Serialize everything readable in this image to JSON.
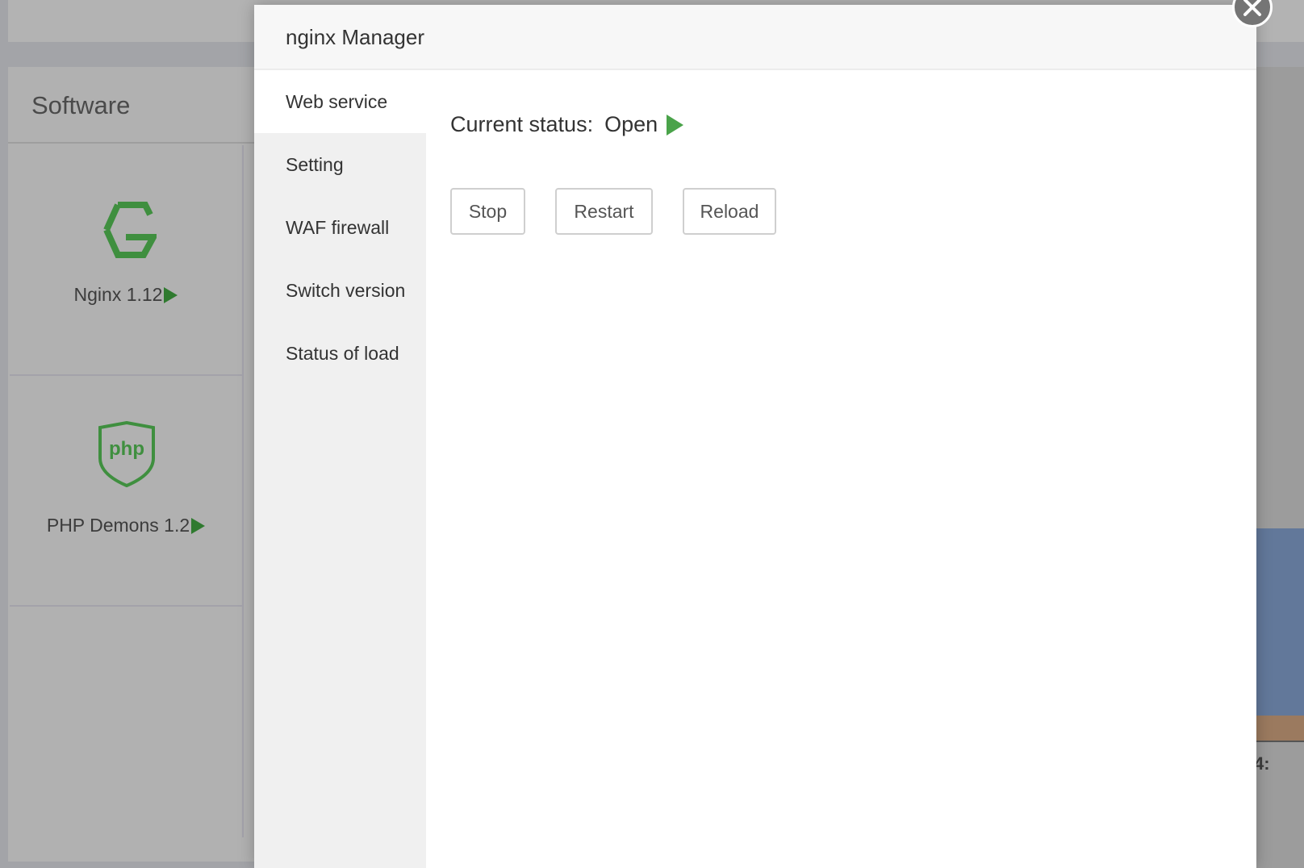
{
  "background": {
    "panel_title": "Software",
    "cards": [
      {
        "name": "Nginx 1.12",
        "icon": "nginx-logo-icon",
        "running": true
      },
      {
        "name": "PHP Demons 1.2",
        "icon": "php-shield-icon",
        "running": true
      }
    ],
    "chart_axis_fragment": "4:"
  },
  "modal": {
    "title": "nginx Manager",
    "close_icon": "close-icon",
    "nav": [
      {
        "label": "Web service",
        "active": true
      },
      {
        "label": "Setting",
        "active": false
      },
      {
        "label": "WAF firewall",
        "active": false
      },
      {
        "label": "Switch version",
        "active": false
      },
      {
        "label": "Status of load",
        "active": false
      }
    ],
    "content": {
      "status_label": "Current status:",
      "status_value": "Open",
      "status_color": "#4aa34a",
      "buttons": {
        "stop": "Stop",
        "restart": "Restart",
        "reload": "Reload"
      }
    }
  },
  "colors": {
    "accent_green": "#4aa34a",
    "icon_green": "#3f8f3f"
  }
}
